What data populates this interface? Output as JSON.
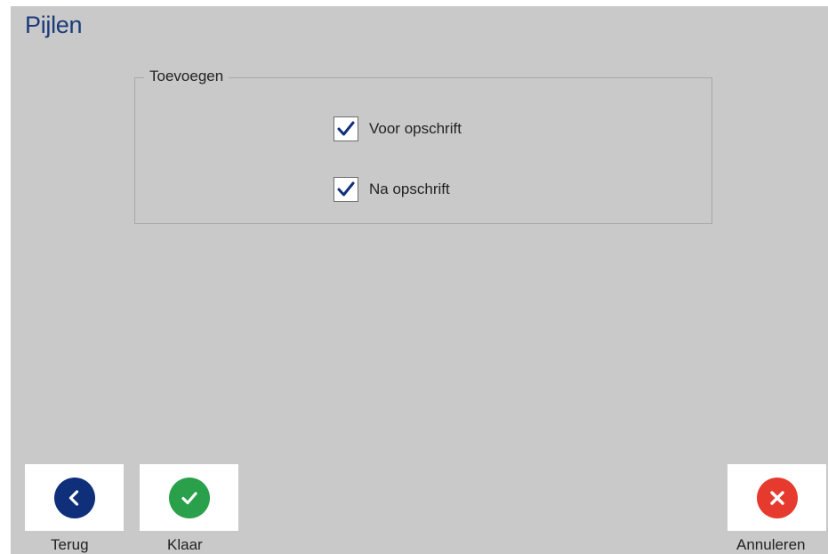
{
  "header": {
    "title": "Pijlen"
  },
  "group": {
    "legend": "Toevoegen",
    "options": [
      {
        "label": "Voor opschrift",
        "checked": true
      },
      {
        "label": "Na opschrift",
        "checked": true
      }
    ]
  },
  "footer": {
    "back": {
      "label": "Terug",
      "icon": "chevron-left-icon",
      "color": "#0f2f7a"
    },
    "done": {
      "label": "Klaar",
      "icon": "check-icon",
      "color": "#2aa04a"
    },
    "cancel": {
      "label": "Annuleren",
      "icon": "close-icon",
      "color": "#e63a2e"
    }
  },
  "colors": {
    "background": "#c9c9c9",
    "title": "#1a3a7a",
    "checkmark": "#12307a"
  }
}
